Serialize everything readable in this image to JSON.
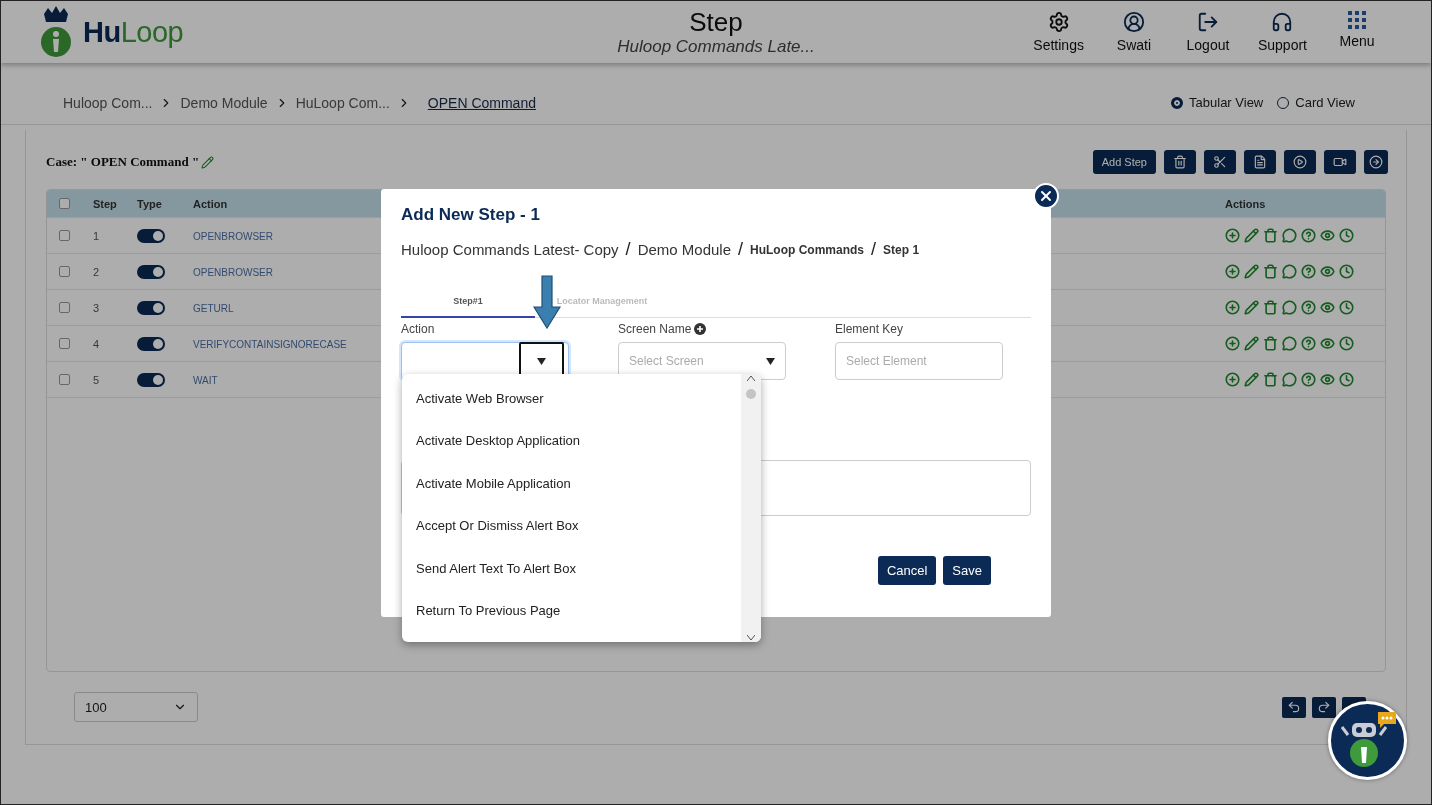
{
  "header": {
    "logo": [
      "Hu",
      "Loop"
    ],
    "title": "Step",
    "subtitle": "Huloop Commands Late...",
    "nav": [
      {
        "label": "Settings"
      },
      {
        "label": "Swati"
      },
      {
        "label": "Logout"
      },
      {
        "label": "Support"
      },
      {
        "label": "Menu"
      }
    ]
  },
  "breadcrumb": [
    "Huloop Com...",
    "Demo Module",
    "HuLoop Com...",
    "OPEN Command"
  ],
  "views": [
    {
      "label": "Tabular View",
      "selected": true
    },
    {
      "label": "Card View",
      "selected": false
    }
  ],
  "case_title": "Case: \" OPEN Command \"",
  "toolbar": {
    "add_label": "Add Step"
  },
  "table": {
    "columns": [
      "Step",
      "Type",
      "Action",
      "Actions"
    ],
    "all_checked": false,
    "rows": [
      {
        "checked": false,
        "step": "1",
        "on": true,
        "action": "OPENBROWSER"
      },
      {
        "checked": false,
        "step": "2",
        "on": true,
        "action": "OPENBROWSER"
      },
      {
        "checked": false,
        "step": "3",
        "on": true,
        "action": "GETURL"
      },
      {
        "checked": false,
        "step": "4",
        "on": true,
        "action": "VERIFYCONTAINSIGNORECASE"
      },
      {
        "checked": false,
        "step": "5",
        "on": true,
        "action": "WAIT"
      }
    ]
  },
  "page_size": "100",
  "modal": {
    "title": "Add New Step - 1",
    "separator": "/",
    "path": [
      "Huloop Commands Latest- Copy",
      "Demo Module",
      "HuLoop Commands",
      "Step 1"
    ],
    "tabs": [
      {
        "label": "Step#1",
        "selected": true
      },
      {
        "label": "Locator Management",
        "selected": false
      }
    ],
    "fields": [
      {
        "kind": "combo",
        "label": "Action",
        "addable": false
      },
      {
        "kind": "select",
        "label": "Screen Name",
        "placeholder": "Select Screen",
        "addable": true
      },
      {
        "kind": "input",
        "label": "Element Key",
        "placeholder": "Select Element",
        "addable": false
      }
    ],
    "options": [
      "Activate Web Browser",
      "Activate Desktop Application",
      "Activate Mobile Application",
      "Accept Or Dismiss Alert Box",
      "Send Alert Text To Alert Box",
      "Return To Previous Page"
    ],
    "buttons": [
      "Cancel",
      "Save"
    ]
  }
}
